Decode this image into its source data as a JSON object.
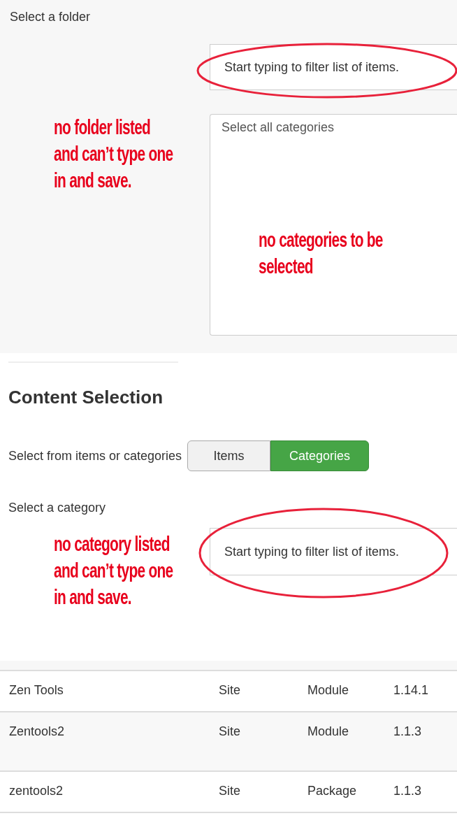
{
  "folder_section": {
    "label": "Select a folder",
    "filter_field": {
      "placeholder": "Start typing to filter list of items."
    },
    "category_list": {
      "items": [
        "Select all categories"
      ]
    },
    "annotations": [
      {
        "text": "no folder listed\nand can’t type one\nin and save."
      },
      {
        "text": "no categories to be\nselected"
      }
    ]
  },
  "content_selection": {
    "title": "Content Selection",
    "source_label": "Select from items or categories",
    "toggle": [
      {
        "label": "Items",
        "selected": false
      },
      {
        "label": "Categories",
        "selected": true
      }
    ],
    "category_label": "Select a category",
    "filter_field": {
      "placeholder": "Start typing to filter list of items."
    },
    "annotations": [
      {
        "text": "no category listed\nand can’t type one\nin and save."
      }
    ]
  },
  "table": {
    "rows": [
      {
        "cells": [
          "Zen Tools",
          "Site",
          "Module",
          "1.14.1"
        ]
      },
      {
        "cells": [
          "Zentools2",
          "Site",
          "Module",
          "1.1.3"
        ]
      },
      {
        "cells": [
          "zentools2",
          "Site",
          "Package",
          "1.1.3"
        ]
      }
    ]
  }
}
